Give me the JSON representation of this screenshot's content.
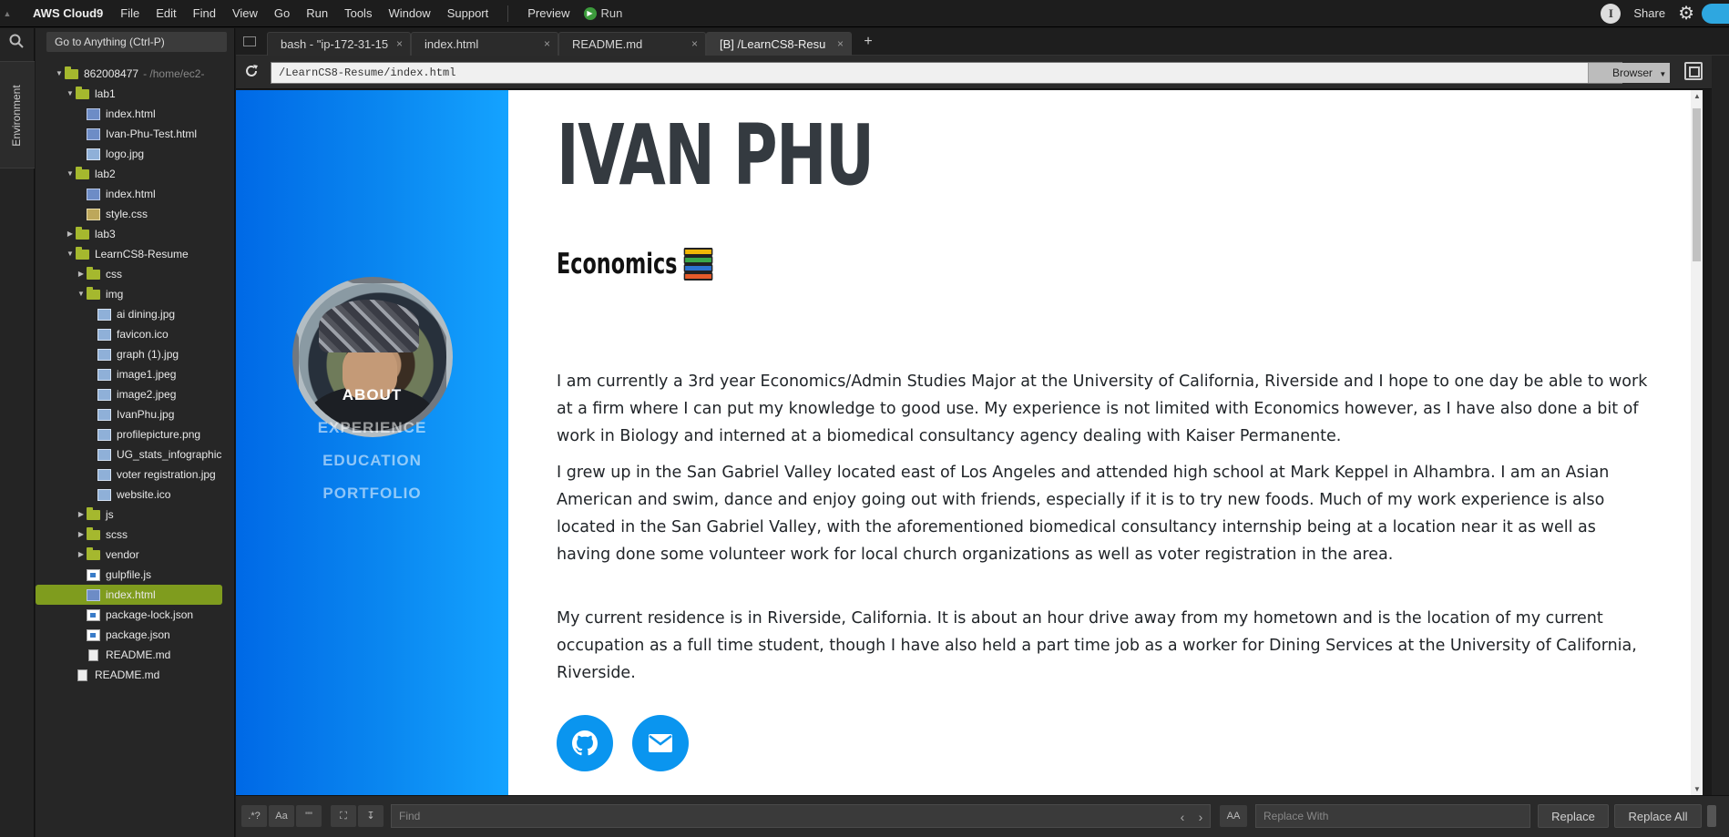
{
  "app": {
    "brand": "AWS Cloud9",
    "menu": [
      "File",
      "Edit",
      "Find",
      "View",
      "Go",
      "Run",
      "Tools",
      "Window",
      "Support"
    ],
    "preview_label": "Preview",
    "run_label": "Run",
    "share_label": "Share",
    "info_glyph": "I"
  },
  "left_strip": {
    "environment_label": "Environment"
  },
  "tree": {
    "goto_placeholder": "Go to Anything (Ctrl-P)",
    "root_label": "862008477",
    "root_path": "- /home/ec2-",
    "items": [
      {
        "label": "lab1",
        "kind": "folder",
        "open": true,
        "depth": 1
      },
      {
        "label": "index.html",
        "kind": "html",
        "depth": 2
      },
      {
        "label": "Ivan-Phu-Test.html",
        "kind": "html",
        "depth": 2
      },
      {
        "label": "logo.jpg",
        "kind": "img",
        "depth": 2
      },
      {
        "label": "lab2",
        "kind": "folder",
        "open": true,
        "depth": 1
      },
      {
        "label": "index.html",
        "kind": "html",
        "depth": 2
      },
      {
        "label": "style.css",
        "kind": "css",
        "depth": 2
      },
      {
        "label": "lab3",
        "kind": "folder",
        "open": false,
        "depth": 1
      },
      {
        "label": "LearnCS8-Resume",
        "kind": "folder",
        "open": true,
        "depth": 1
      },
      {
        "label": "css",
        "kind": "folder",
        "open": false,
        "depth": 2
      },
      {
        "label": "img",
        "kind": "folder",
        "open": true,
        "depth": 2
      },
      {
        "label": "ai dining.jpg",
        "kind": "img",
        "depth": 3
      },
      {
        "label": "favicon.ico",
        "kind": "img",
        "depth": 3
      },
      {
        "label": "graph (1).jpg",
        "kind": "img",
        "depth": 3
      },
      {
        "label": "image1.jpeg",
        "kind": "img",
        "depth": 3
      },
      {
        "label": "image2.jpeg",
        "kind": "img",
        "depth": 3
      },
      {
        "label": "IvanPhu.jpg",
        "kind": "img",
        "depth": 3
      },
      {
        "label": "profilepicture.png",
        "kind": "img",
        "depth": 3
      },
      {
        "label": "UG_stats_infographic",
        "kind": "img",
        "depth": 3
      },
      {
        "label": "voter registration.jpg",
        "kind": "img",
        "depth": 3
      },
      {
        "label": "website.ico",
        "kind": "img",
        "depth": 3
      },
      {
        "label": "js",
        "kind": "folder",
        "open": false,
        "depth": 2
      },
      {
        "label": "scss",
        "kind": "folder",
        "open": false,
        "depth": 2
      },
      {
        "label": "vendor",
        "kind": "folder",
        "open": false,
        "depth": 2
      },
      {
        "label": "gulpfile.js",
        "kind": "js",
        "depth": 2
      },
      {
        "label": "index.html",
        "kind": "html",
        "depth": 2,
        "selected": true
      },
      {
        "label": "package-lock.json",
        "kind": "js",
        "depth": 2
      },
      {
        "label": "package.json",
        "kind": "js",
        "depth": 2
      },
      {
        "label": "README.md",
        "kind": "doc",
        "depth": 2
      },
      {
        "label": "README.md",
        "kind": "doc",
        "depth": 1
      }
    ]
  },
  "tabs": [
    {
      "label": "bash - \"ip-172-31-15",
      "close": "×"
    },
    {
      "label": "index.html",
      "close": "×"
    },
    {
      "label": "README.md",
      "close": "×"
    },
    {
      "label": "[B] /LearnCS8-Resu",
      "close": "×",
      "active": true
    }
  ],
  "tab_add": "+",
  "browser": {
    "url": "/LearnCS8-Resume/index.html",
    "browser_button": "Browser"
  },
  "resume": {
    "name": "IVAN PHU",
    "subheading": "Economics",
    "nav": [
      "ABOUT",
      "EXPERIENCE",
      "EDUCATION",
      "PORTFOLIO"
    ],
    "paragraphs": [
      "I am currently a 3rd year Economics/Admin Studies Major at the University of California, Riverside and I hope to one day be able to work at a firm where I can put my knowledge to good use. My experience is not limited with Economics however, as I have also done a bit of work in Biology and interned at a biomedical consultancy agency dealing with Kaiser Permanente.",
      "I grew up in the San Gabriel Valley located east of Los Angeles and attended high school at Mark Keppel in Alhambra. I am an Asian American and swim, dance and enjoy going out with friends, especially if it is to try new foods. Much of my work experience is also located in the San Gabriel Valley, with the aforementioned biomedical consultancy internship being at a location near it as well as having done some volunteer work for local church organizations as well as voter registration in the area.",
      "My current residence is in Riverside, California. It is about an hour drive away from my hometown and is the location of my current occupation as a full time student, though I have also held a part time job as a worker for Dining Services at the University of California, Riverside."
    ],
    "social_icons": [
      "github-icon",
      "envelope-icon"
    ],
    "colors": {
      "sidebar": "#0a87f0",
      "social": "#0a95ef",
      "heading": "#343a40"
    }
  },
  "findbar": {
    "regex_label": ".*?",
    "case_label": "Aa",
    "word_label": "\"\"",
    "find_placeholder": "Find",
    "replace_placeholder": "Replace With",
    "case_toggle_label": "AA",
    "replace_label": "Replace",
    "replace_all_label": "Replace All"
  }
}
